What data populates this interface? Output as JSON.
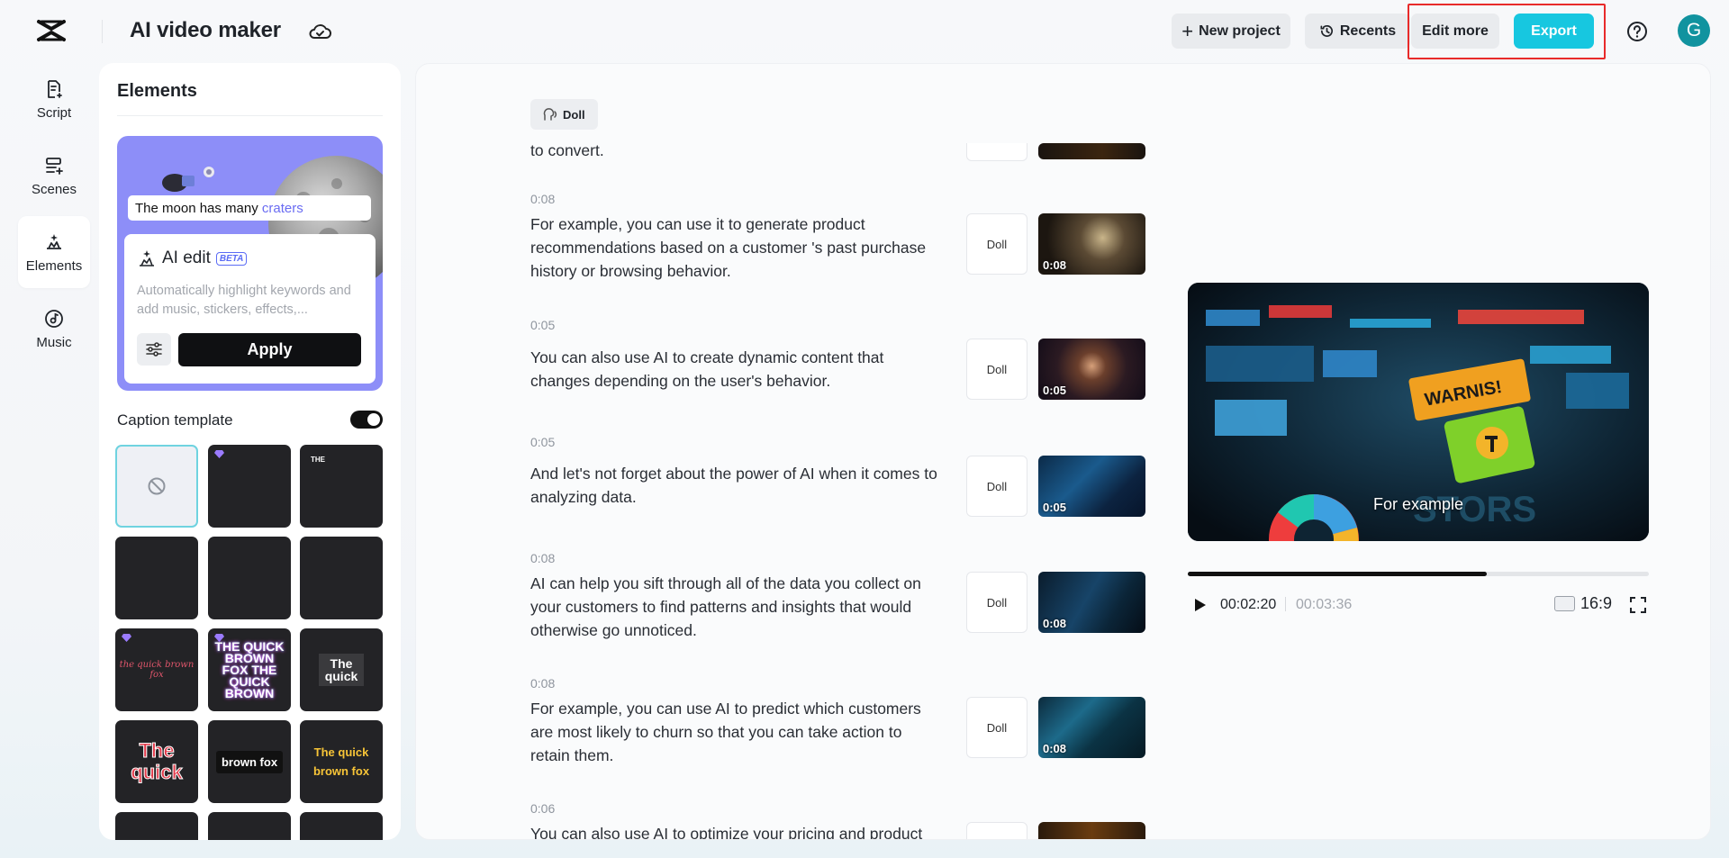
{
  "header": {
    "title": "AI video maker",
    "new_project": "New project",
    "recents": "Recents",
    "edit_more": "Edit more",
    "export": "Export",
    "avatar_letter": "G"
  },
  "rail": [
    {
      "label": "Script",
      "icon": "script-icon",
      "active": false
    },
    {
      "label": "Scenes",
      "icon": "scenes-icon",
      "active": false
    },
    {
      "label": "Elements",
      "icon": "elements-icon",
      "active": true
    },
    {
      "label": "Music",
      "icon": "music-icon",
      "active": false
    }
  ],
  "elements_panel": {
    "title": "Elements",
    "promo_caption_prefix": "The moon has many ",
    "promo_caption_highlight": "craters",
    "ai_edit_title": "AI edit",
    "ai_edit_badge": "BETA",
    "ai_edit_desc": "Automatically highlight keywords and add music, stickers, effects,...",
    "apply_label": "Apply",
    "caption_template_label": "Caption template",
    "caption_template_enabled": true,
    "templates": [
      {
        "type": "none",
        "text": ""
      },
      {
        "type": "premium",
        "text": ""
      },
      {
        "type": "small",
        "text": "THE"
      },
      {
        "type": "blank",
        "text": ""
      },
      {
        "type": "blank",
        "text": ""
      },
      {
        "type": "blank",
        "text": ""
      },
      {
        "type": "script",
        "text": "the quick brown fox"
      },
      {
        "type": "neon",
        "text": "THE QUICK BROWN FOX THE QUICK BROWN"
      },
      {
        "type": "boxed",
        "text": "The quick"
      },
      {
        "type": "red",
        "text": "The quick"
      },
      {
        "type": "pill",
        "text": "brown fox"
      },
      {
        "type": "yellow",
        "text": "The quick brown fox"
      }
    ]
  },
  "script": {
    "voice_chip": "Doll",
    "partial_top_text": "to convert.",
    "scenes": [
      {
        "duration": "0:08",
        "text": "For example, you can use it to generate product recommendations based on a customer 's past purchase history or browsing behavior.",
        "voice": "Doll",
        "thumb_time": "0:08"
      },
      {
        "duration": "0:05",
        "text": "You can also use AI to create dynamic content that changes depending on the user's behavior.",
        "voice": "Doll",
        "thumb_time": "0:05"
      },
      {
        "duration": "0:05",
        "text": "And let's not forget about the power of AI when it comes to analyzing data.",
        "voice": "Doll",
        "thumb_time": "0:05"
      },
      {
        "duration": "0:08",
        "text": "AI can help you sift through all of the data you collect on your customers to find patterns and insights that would otherwise go unnoticed.",
        "voice": "Doll",
        "thumb_time": "0:08"
      },
      {
        "duration": "0:08",
        "text": "For example, you can use AI to predict which customers are most likely to churn so that you can take action to retain them.",
        "voice": "Doll",
        "thumb_time": "0:08"
      },
      {
        "duration": "0:06",
        "text": "You can also use AI to optimize your pricing and product",
        "voice": "",
        "thumb_time": ""
      }
    ]
  },
  "preview": {
    "caption": "For example",
    "current_time": "00:02:20",
    "total_time": "00:03:36",
    "progress": 0.648,
    "aspect_ratio": "16:9"
  },
  "colors": {
    "accent": "#17c7e0",
    "highlight_box": "#e82a2a",
    "promo_bg": "#8d8ef8",
    "avatar": "#11939f"
  }
}
